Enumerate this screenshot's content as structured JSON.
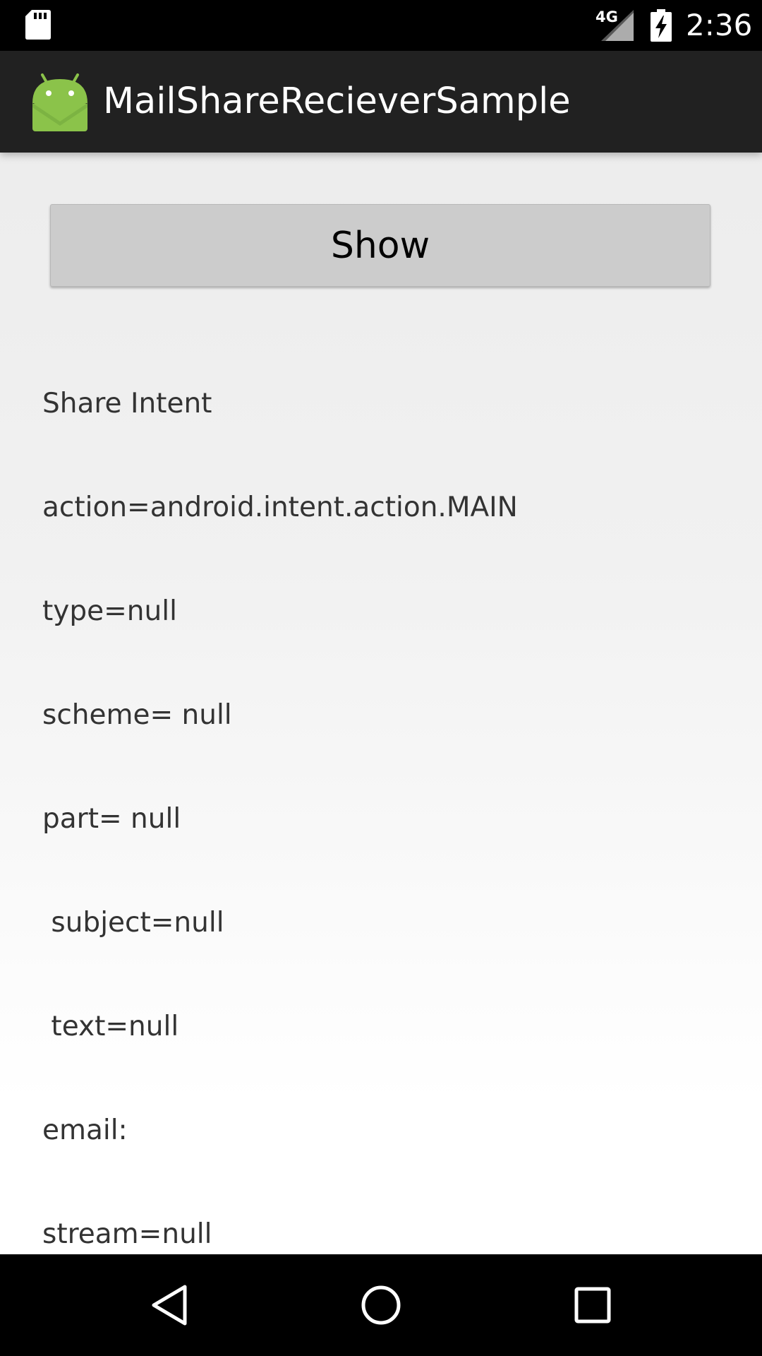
{
  "status_bar": {
    "network_type": "4G",
    "time": "2:36",
    "icons": [
      "sd-card-icon",
      "cell-signal-icon",
      "battery-charging-icon"
    ]
  },
  "action_bar": {
    "app_icon": "android-robot-icon",
    "title": "MailShareRecieverSample"
  },
  "main": {
    "show_button_label": "Show",
    "info_lines": [
      "Share Intent",
      "action=android.intent.action.MAIN",
      "type=null",
      "scheme= null",
      "part= null",
      " subject=null",
      " text=null",
      "email: ",
      "stream=null"
    ]
  },
  "nav_bar": {
    "buttons": [
      "back-icon",
      "home-icon",
      "recents-icon"
    ]
  },
  "colors": {
    "status_bar_bg": "#000000",
    "action_bar_bg": "#212121",
    "android_green": "#8bc34a",
    "button_bg": "#cccccc",
    "text_color": "#333333",
    "nav_bar_bg": "#000000"
  }
}
